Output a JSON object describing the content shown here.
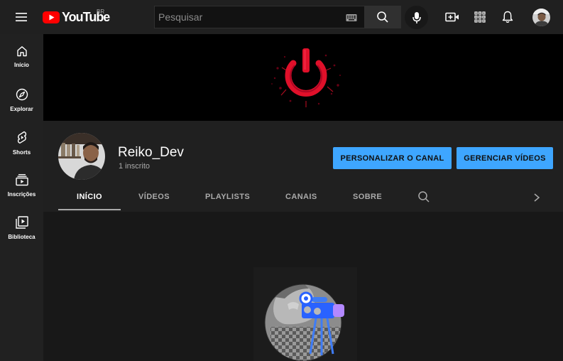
{
  "masthead": {
    "logo_text": "YouTube",
    "logo_country": "BR",
    "search_placeholder": "Pesquisar",
    "icons": {
      "menu": "hamburger-menu-icon",
      "keyboard": "keyboard-icon",
      "search": "search-icon",
      "mic": "microphone-icon",
      "create": "create-video-icon",
      "apps": "apps-grid-icon",
      "notifications": "bell-icon",
      "account": "user-avatar"
    }
  },
  "guide": {
    "items": [
      {
        "label": "Início",
        "icon": "home-icon"
      },
      {
        "label": "Explorar",
        "icon": "compass-icon"
      },
      {
        "label": "Shorts",
        "icon": "shorts-icon"
      },
      {
        "label": "Inscrições",
        "icon": "subscriptions-icon"
      },
      {
        "label": "Biblioteca",
        "icon": "library-icon"
      }
    ]
  },
  "channel": {
    "name": "Reiko_Dev",
    "subscribers": "1 inscrito",
    "buttons": {
      "customize": "PERSONALIZAR O CANAL",
      "manage": "GERENCIAR VÍDEOS"
    },
    "tabs": [
      "INÍCIO",
      "VÍDEOS",
      "PLAYLISTS",
      "CANAIS",
      "SOBRE"
    ],
    "active_tab": "INÍCIO"
  },
  "colors": {
    "brand_red": "#ff0000",
    "accent_blue": "#3ea6ff",
    "banner_logo_red": "#e0102a"
  }
}
